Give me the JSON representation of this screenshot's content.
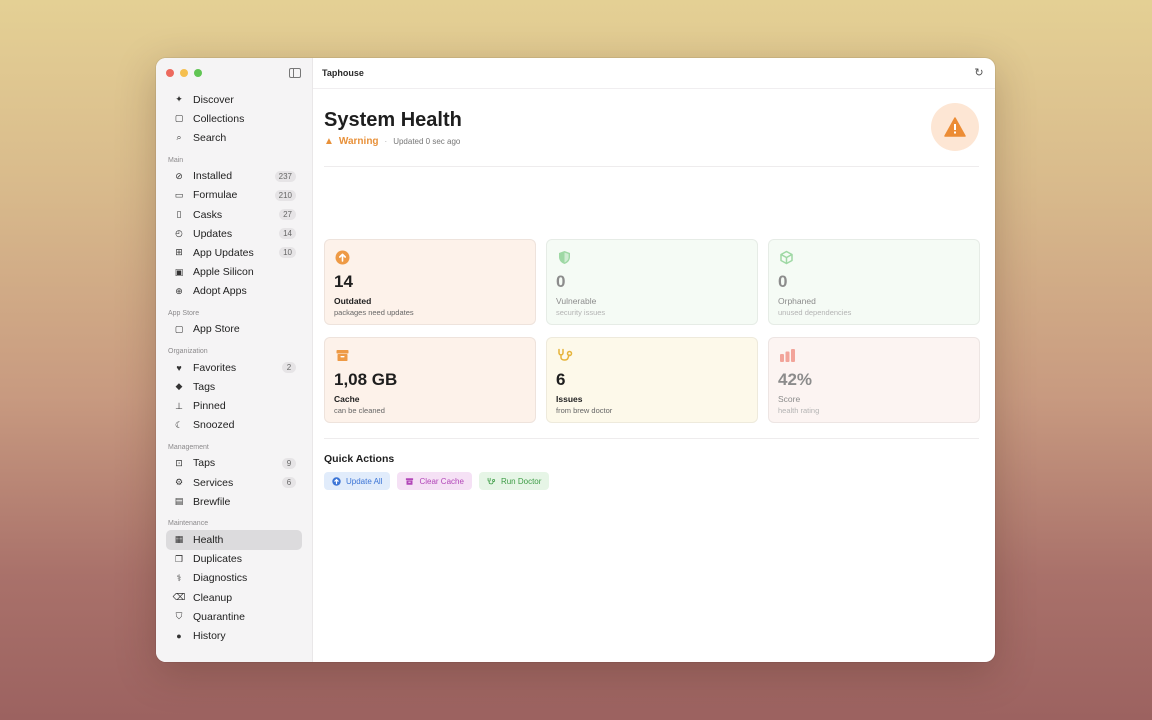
{
  "app": {
    "title": "Taphouse"
  },
  "sidebar": {
    "top": [
      {
        "icon": "sparkle-icon",
        "glyph": "✦",
        "label": "Discover"
      },
      {
        "icon": "collections-icon",
        "glyph": "▢",
        "label": "Collections"
      },
      {
        "icon": "search-icon",
        "glyph": "⌕",
        "label": "Search"
      }
    ],
    "sections": [
      {
        "title": "Main",
        "items": [
          {
            "icon": "check-circle-icon",
            "glyph": "⊘",
            "label": "Installed",
            "badge": "237"
          },
          {
            "icon": "terminal-icon",
            "glyph": "▭",
            "label": "Formulae",
            "badge": "210"
          },
          {
            "icon": "cask-icon",
            "glyph": "▯",
            "label": "Casks",
            "badge": "27"
          },
          {
            "icon": "clock-icon",
            "glyph": "◴",
            "label": "Updates",
            "badge": "14"
          },
          {
            "icon": "app-updates-icon",
            "glyph": "⊞",
            "label": "App Updates",
            "badge": "10"
          },
          {
            "icon": "chip-icon",
            "glyph": "▣",
            "label": "Apple Silicon",
            "badge": ""
          },
          {
            "icon": "adopt-icon",
            "glyph": "⊕",
            "label": "Adopt Apps",
            "badge": ""
          }
        ]
      },
      {
        "title": "App Store",
        "items": [
          {
            "icon": "bag-icon",
            "glyph": "▢",
            "label": "App Store",
            "badge": ""
          }
        ]
      },
      {
        "title": "Organization",
        "items": [
          {
            "icon": "heart-icon",
            "glyph": "♥",
            "label": "Favorites",
            "badge": "2"
          },
          {
            "icon": "tag-icon",
            "glyph": "◆",
            "label": "Tags",
            "badge": ""
          },
          {
            "icon": "pin-icon",
            "glyph": "⊥",
            "label": "Pinned",
            "badge": ""
          },
          {
            "icon": "moon-icon",
            "glyph": "☾",
            "label": "Snoozed",
            "badge": ""
          }
        ]
      },
      {
        "title": "Management",
        "items": [
          {
            "icon": "taps-icon",
            "glyph": "⊡",
            "label": "Taps",
            "badge": "9"
          },
          {
            "icon": "gears-icon",
            "glyph": "⚙",
            "label": "Services",
            "badge": "6"
          },
          {
            "icon": "doc-icon",
            "glyph": "▤",
            "label": "Brewfile",
            "badge": ""
          }
        ]
      },
      {
        "title": "Maintenance",
        "items": [
          {
            "icon": "health-icon",
            "glyph": "▦",
            "label": "Health",
            "badge": "",
            "active": true
          },
          {
            "icon": "duplicates-icon",
            "glyph": "❐",
            "label": "Duplicates",
            "badge": ""
          },
          {
            "icon": "diagnostics-icon",
            "glyph": "⚕",
            "label": "Diagnostics",
            "badge": ""
          },
          {
            "icon": "trash-icon",
            "glyph": "⌫",
            "label": "Cleanup",
            "badge": ""
          },
          {
            "icon": "shield-icon",
            "glyph": "⛉",
            "label": "Quarantine",
            "badge": ""
          },
          {
            "icon": "history-icon",
            "glyph": "●",
            "label": "History",
            "badge": ""
          }
        ]
      }
    ]
  },
  "main": {
    "title": "System Health",
    "status": "Warning",
    "updated": "Updated 0 sec ago",
    "cards": [
      {
        "value": "14",
        "title": "Outdated",
        "sub": "packages need updates",
        "bg": "c-orange",
        "tone": "dark",
        "icon": "arrow-up-circle-icon",
        "color": "#ee9a45"
      },
      {
        "value": "0",
        "title": "Vulnerable",
        "sub": "security issues",
        "bg": "c-green",
        "tone": "muted",
        "icon": "shield-icon",
        "color": "#9ed8a4"
      },
      {
        "value": "0",
        "title": "Orphaned",
        "sub": "unused dependencies",
        "bg": "c-green",
        "tone": "muted",
        "icon": "cube-icon",
        "color": "#9ed8a4"
      },
      {
        "value": "1,08 GB",
        "title": "Cache",
        "sub": "can be cleaned",
        "bg": "c-orange",
        "tone": "dark",
        "icon": "archive-box-icon",
        "color": "#ee9a45"
      },
      {
        "value": "6",
        "title": "Issues",
        "sub": "from brew doctor",
        "bg": "c-yellow",
        "tone": "dark",
        "icon": "stethoscope-icon",
        "color": "#e6b43a"
      },
      {
        "value": "42%",
        "title": "Score",
        "sub": "health rating",
        "bg": "c-pink",
        "tone": "muted",
        "icon": "bar-chart-icon",
        "color": "#f2a49a"
      }
    ],
    "quick_actions": {
      "title": "Quick Actions",
      "buttons": [
        {
          "label": "Update All",
          "style": "blue",
          "icon": "arrow-up-circle-icon"
        },
        {
          "label": "Clear Cache",
          "style": "purple",
          "icon": "archive-box-icon"
        },
        {
          "label": "Run Doctor",
          "style": "green",
          "icon": "stethoscope-icon"
        }
      ]
    }
  },
  "colors": {
    "warning": "#e8913a",
    "accent_blue": "#3b74d6"
  }
}
